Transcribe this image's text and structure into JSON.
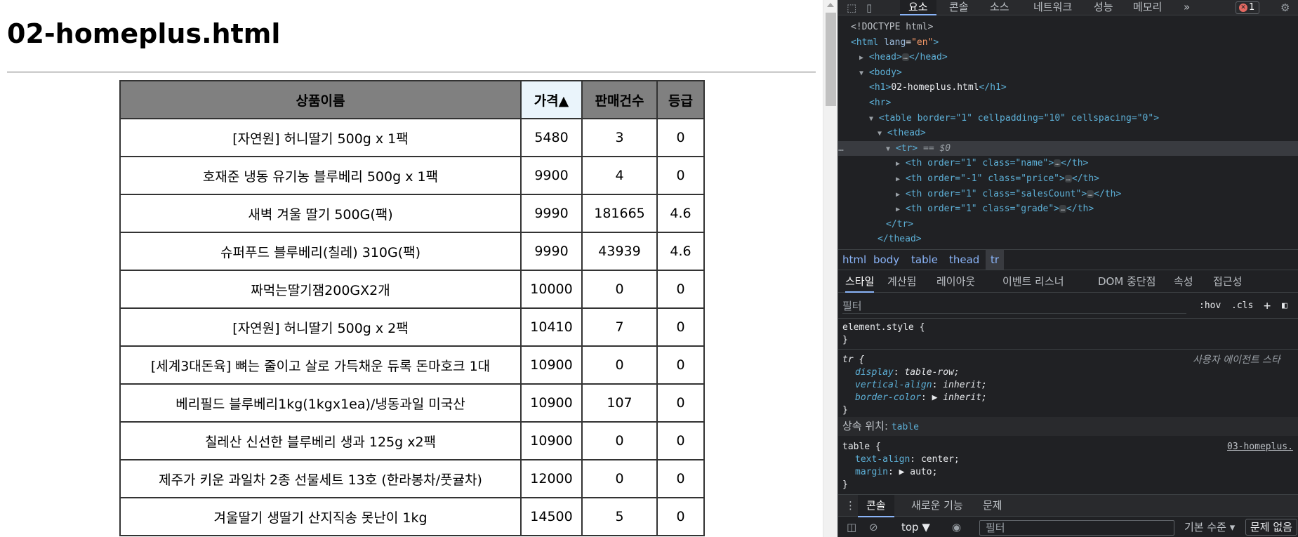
{
  "page": {
    "heading": "02-homeplus.html",
    "table": {
      "headers": {
        "name": "상품이름",
        "price": "가격▲",
        "sales": "판매건수",
        "grade": "등급"
      },
      "rows": [
        {
          "name": "[자연원] 허니딸기 500g x 1팩",
          "price": "5480",
          "sales": "3",
          "grade": "0"
        },
        {
          "name": "호재준 냉동 유기농 블루베리 500g x 1팩",
          "price": "9900",
          "sales": "4",
          "grade": "0"
        },
        {
          "name": "새벽 겨울 딸기 500G(팩)",
          "price": "9990",
          "sales": "181665",
          "grade": "4.6"
        },
        {
          "name": "슈퍼푸드 블루베리(칠레) 310G(팩)",
          "price": "9990",
          "sales": "43939",
          "grade": "4.6"
        },
        {
          "name": "짜먹는딸기잼200GX2개",
          "price": "10000",
          "sales": "0",
          "grade": "0"
        },
        {
          "name": "[자연원] 허니딸기 500g x 2팩",
          "price": "10410",
          "sales": "7",
          "grade": "0"
        },
        {
          "name": "[세계3대돈육] 뼈는 줄이고 살로 가득채운 듀록 돈마호크 1대",
          "price": "10900",
          "sales": "0",
          "grade": "0"
        },
        {
          "name": "베리필드 블루베리1kg(1kgx1ea)/냉동과일 미국산",
          "price": "10900",
          "sales": "107",
          "grade": "0"
        },
        {
          "name": "칠레산 신선한 블루베리 생과 125g x2팩",
          "price": "10900",
          "sales": "0",
          "grade": "0"
        },
        {
          "name": "제주가 키운 과일차 2종 선물세트 13호 (한라봉차/풋귤차)",
          "price": "12000",
          "sales": "0",
          "grade": "0"
        },
        {
          "name": "겨울딸기 생딸기 산지직송 못난이 1kg",
          "price": "14500",
          "sales": "5",
          "grade": "0"
        }
      ]
    }
  },
  "devtools": {
    "tabs": [
      "요소",
      "콘솔",
      "소스",
      "네트워크",
      "성능",
      "메모리"
    ],
    "more": "»",
    "error_count": "1",
    "dom": [
      {
        "tri": "",
        "html": "<!DOCTYPE html>"
      },
      {
        "tri": "",
        "tag_open": "<html ",
        "attr": "lang",
        "val": "\"en\"",
        "tag_close": ">"
      },
      {
        "tri": "▶",
        "tag": "<head>",
        "ell": "…",
        "tag2": "</head>"
      },
      {
        "tri": "▼",
        "tag": "<body>"
      },
      {
        "tri": "",
        "tag": "<h1>",
        "text": "02-homeplus.html",
        "tag2": "</h1>"
      },
      {
        "tri": "",
        "tag": "<hr>"
      },
      {
        "tri": "▼",
        "table": "<table border=\"1\" cellpadding=\"10\" cellspacing=\"0\">"
      },
      {
        "tri": "▼",
        "tag": "<thead>"
      },
      {
        "tri": "▼",
        "tag": "<tr>",
        "eq": " == $0"
      },
      {
        "tri": "▶",
        "th": "<th order=\"1\" class=\"name\">",
        "ell": "…",
        "tag2": "</th>"
      },
      {
        "tri": "▶",
        "th": "<th order=\"-1\" class=\"price\">",
        "ell": "…",
        "tag2": "</th>"
      },
      {
        "tri": "▶",
        "th": "<th order=\"1\" class=\"salesCount\">",
        "ell": "…",
        "tag2": "</th>"
      },
      {
        "tri": "▶",
        "th": "<th order=\"1\" class=\"grade\">",
        "ell": "…",
        "tag2": "</th>"
      },
      {
        "tri": "",
        "tag": "</tr>"
      },
      {
        "tri": "",
        "tag": "</thead>"
      }
    ],
    "breadcrumb": [
      "html",
      "body",
      "table",
      "thead",
      "tr"
    ],
    "sub_tabs": [
      "스타일",
      "계산됨",
      "레이아웃",
      "이벤트 리스너",
      "DOM 중단점",
      "속성",
      "접근성"
    ],
    "filter_placeholder": "필터",
    "filter_hov": ":hov",
    "filter_cls": ".cls",
    "styles": {
      "element_style": "element.style {",
      "close": "}",
      "tr_selector": "tr {",
      "ua_label": "사용자 에이전트 스타",
      "tr_props": [
        {
          "p": "display",
          "v": "table-row;"
        },
        {
          "p": "vertical-align",
          "v": "inherit;"
        },
        {
          "p": "border-color",
          "v": "▶ inherit;"
        }
      ],
      "inherit_label": "상속 위치:",
      "inherit_tag": "table",
      "table_selector": "table {",
      "table_source": "03-homeplus.",
      "table_props": [
        {
          "p": "text-align",
          "v": "center;"
        },
        {
          "p": "margin",
          "v": "▶ auto;"
        }
      ]
    },
    "drawer_tabs": [
      "콘솔",
      "새로운 기능",
      "문제"
    ],
    "console": {
      "context": "top ▼",
      "filter_placeholder": "필터",
      "level": "기본 수준 ▾",
      "no_issues": "문제 없음"
    }
  }
}
